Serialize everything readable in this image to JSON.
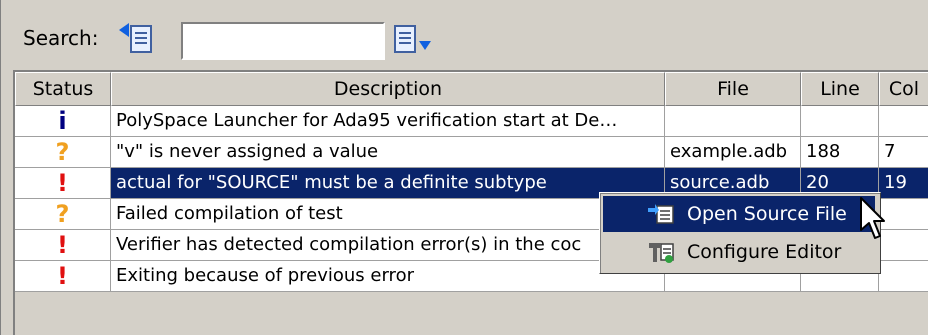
{
  "search": {
    "label": "Search:",
    "value": "",
    "prev_icon": "find-previous-icon",
    "next_icon": "find-next-icon"
  },
  "table": {
    "columns": [
      "Status",
      "Description",
      "File",
      "Line",
      "Col"
    ],
    "rows": [
      {
        "status": "info",
        "glyph": "i",
        "description": "PolySpace Launcher for Ada95 verification start at De…",
        "file": "",
        "line": "",
        "col": ""
      },
      {
        "status": "warning",
        "glyph": "?",
        "description": "\"v\" is never assigned a value",
        "file": "example.adb",
        "line": "188",
        "col": "7"
      },
      {
        "status": "error",
        "glyph": "!",
        "description": "actual for \"SOURCE\" must be a definite subtype",
        "file": "source.adb",
        "line": "20",
        "col": "19",
        "selected": true
      },
      {
        "status": "warning",
        "glyph": "?",
        "description": "Failed compilation of test",
        "file": "",
        "line": "",
        "col": ""
      },
      {
        "status": "error",
        "glyph": "!",
        "description": "Verifier has detected compilation error(s) in the coc",
        "file": "",
        "line": "",
        "col": ""
      },
      {
        "status": "error",
        "glyph": "!",
        "description": "Exiting because of previous error",
        "file": "",
        "line": "",
        "col": ""
      }
    ]
  },
  "context_menu": {
    "items": [
      {
        "label": "Open Source File",
        "icon": "open-source-file-icon",
        "highlighted": true
      },
      {
        "label": "Configure Editor",
        "icon": "configure-editor-icon",
        "highlighted": false
      }
    ]
  },
  "colors": {
    "selection": "#0a246a",
    "panel": "#d4d0c8",
    "info": "#000080",
    "warning": "#f0a020",
    "error": "#e01010"
  }
}
